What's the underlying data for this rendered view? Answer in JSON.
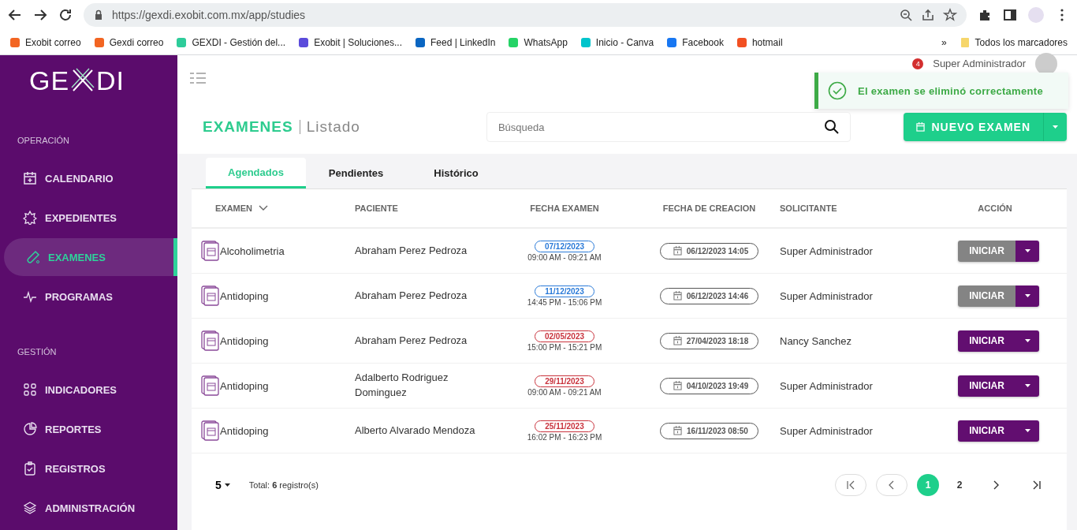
{
  "browser": {
    "url": "https://gexdi.exobit.com.mx/app/studies",
    "bookmarks": [
      {
        "label": "Exobit correo",
        "color": "#f26522"
      },
      {
        "label": "Gexdi correo",
        "color": "#f26522"
      },
      {
        "label": "GEXDI - Gestión del...",
        "color": "#2ecc9a"
      },
      {
        "label": "Exobit | Soluciones...",
        "color": "#5b4bdb"
      },
      {
        "label": "Feed | LinkedIn",
        "color": "#0a66c2"
      },
      {
        "label": "WhatsApp",
        "color": "#25d366"
      },
      {
        "label": "Inicio - Canva",
        "color": "#00c4cc"
      },
      {
        "label": "Facebook",
        "color": "#1877f2"
      },
      {
        "label": "hotmail",
        "color": "#f25022"
      }
    ],
    "more": "»",
    "all_bookmarks": "Todos los marcadores"
  },
  "sidebar": {
    "logo_start": "GE",
    "logo_end": "DI",
    "sections": [
      {
        "title": "OPERACIÓN",
        "items": [
          {
            "label": "CALENDARIO",
            "selected": false
          },
          {
            "label": "EXPEDIENTES",
            "selected": false
          },
          {
            "label": "EXAMENES",
            "selected": true
          },
          {
            "label": "PROGRAMAS",
            "selected": false
          }
        ]
      },
      {
        "title": "GESTIÓN",
        "items": [
          {
            "label": "INDICADORES",
            "selected": false
          },
          {
            "label": "REPORTES",
            "selected": false
          },
          {
            "label": "REGISTROS",
            "selected": false
          },
          {
            "label": "ADMINISTRACIÓN",
            "selected": false
          }
        ]
      }
    ]
  },
  "header": {
    "notifications": "4",
    "user": "Super Administrador"
  },
  "toast": {
    "message": "El examen se eliminó correctamente"
  },
  "page": {
    "title": "EXAMENES",
    "subtitle": "Listado",
    "search": {
      "placeholder": "Búsqueda"
    },
    "new_button": "NUEVO EXAMEN"
  },
  "tabs": [
    {
      "label": "Agendados",
      "selected": true
    },
    {
      "label": "Pendientes",
      "selected": false
    },
    {
      "label": "Histórico",
      "selected": false
    }
  ],
  "table": {
    "columns": [
      "EXAMEN",
      "PACIENTE",
      "FECHA EXAMEN",
      "FECHA DE CREACION",
      "SOLICITANTE",
      "ACCIÓN"
    ],
    "rows": [
      {
        "exam": "Alcoholimetria",
        "patient": "Abraham Perez Pedroza",
        "date": "07/12/2023",
        "color": "#2a7ad8",
        "time": "09:00 AM - 09:21 AM",
        "created": "06/12/2023 14:05",
        "requester": "Super Administrador",
        "action": "INICIAR",
        "disabled": true
      },
      {
        "exam": "Antidoping",
        "patient": "Abraham Perez Pedroza",
        "date": "11/12/2023",
        "color": "#2a7ad8",
        "time": "14:45 PM - 15:06 PM",
        "created": "06/12/2023 14:46",
        "requester": "Super Administrador",
        "action": "INICIAR",
        "disabled": true
      },
      {
        "exam": "Antidoping",
        "patient": "Abraham Perez Pedroza",
        "date": "02/05/2023",
        "color": "#c9333d",
        "time": "15:00 PM - 15:21 PM",
        "created": "27/04/2023 18:18",
        "requester": "Nancy Sanchez",
        "action": "INICIAR",
        "disabled": false
      },
      {
        "exam": "Antidoping",
        "patient": "Adalberto Rodriguez Dominguez",
        "date": "29/11/2023",
        "color": "#c9333d",
        "time": "09:00 AM - 09:21 AM",
        "created": "04/10/2023 19:49",
        "requester": "Super Administrador",
        "action": "INICIAR",
        "disabled": false
      },
      {
        "exam": "Antidoping",
        "patient": "Alberto Alvarado Mendoza",
        "date": "25/11/2023",
        "color": "#c9333d",
        "time": "16:02 PM - 16:23 PM",
        "created": "16/11/2023 08:50",
        "requester": "Super Administrador",
        "action": "INICIAR",
        "disabled": false
      }
    ]
  },
  "footer": {
    "page_size": "5",
    "total": "Total: **6** registro(s)",
    "pages": [
      {
        "label": "1",
        "selected": true
      },
      {
        "label": "2",
        "selected": false
      }
    ]
  }
}
